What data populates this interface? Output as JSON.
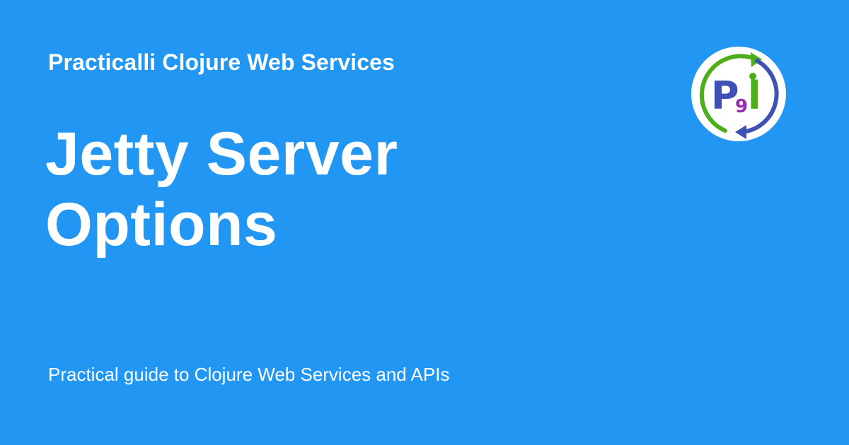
{
  "card": {
    "site_name": "Practicalli Clojure Web Services",
    "title_lines": [
      "Jetty Server",
      "Options"
    ],
    "description": "Practical guide to Clojure Web Services and APIs",
    "logo": {
      "icon": "practicalli-logo-icon",
      "letter_p": "P",
      "letter_9": "9",
      "letter_l": "l"
    }
  },
  "colors": {
    "background": "#2196f3",
    "text": "#ffffff",
    "logo_green": "#4caf1a",
    "logo_blue": "#3f51b5",
    "logo_purple": "#9c27b0"
  }
}
